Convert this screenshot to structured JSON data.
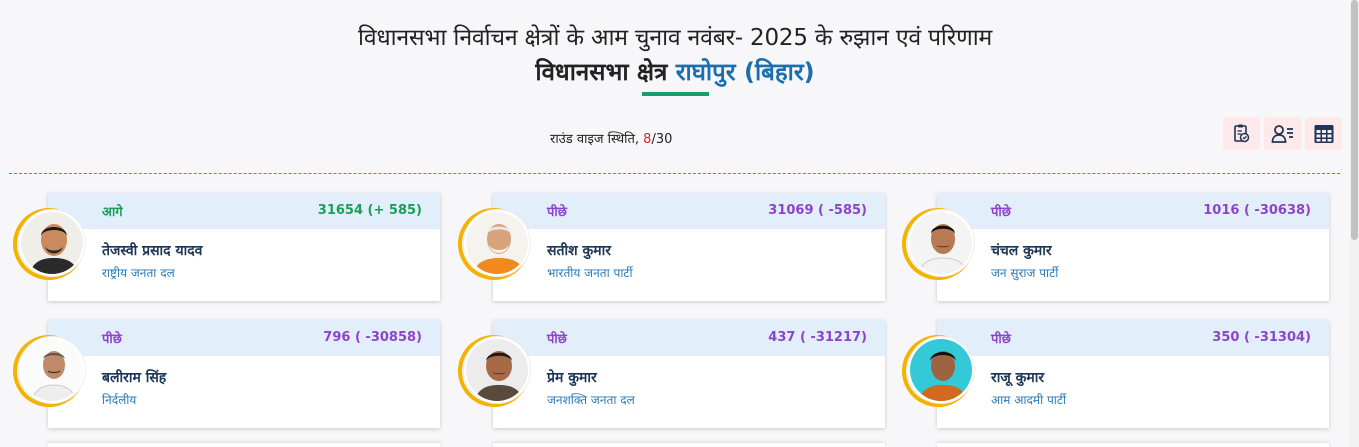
{
  "header": {
    "title_line1": "विधानसभा निर्वाचन क्षेत्रों के आम चुनाव नवंबर- 2025 के रुझान एवं परिणाम",
    "title_prefix": "विधानसभा क्षेत्र ",
    "constituency": "राघोपुर",
    "state": "(बिहार)"
  },
  "round": {
    "label": "राउंड वाइज स्थिति, ",
    "current": "8",
    "total": "/30"
  },
  "toolbar": {
    "icons": [
      "report-icon",
      "candidate-list-icon",
      "table-view-icon"
    ]
  },
  "colors": {
    "lead": "#1b9e5a",
    "trail": "#8e44c8",
    "accent_underline": "#15a06b",
    "ring": "#f5b301"
  },
  "candidates": [
    {
      "status": "आगे",
      "votes": "31654 (+ 585)",
      "name": "तेजस्वी प्रसाद यादव",
      "party": "राष्ट्रीय जनता दल",
      "leading": true
    },
    {
      "status": "पीछे",
      "votes": "31069 ( -585)",
      "name": "सतीश कुमार",
      "party": "भारतीय जनता पार्टी",
      "leading": false
    },
    {
      "status": "पीछे",
      "votes": "1016 ( -30638)",
      "name": "चंचल कुमार",
      "party": "जन सुराज पार्टी",
      "leading": false
    },
    {
      "status": "पीछे",
      "votes": "796 ( -30858)",
      "name": "बलीराम सिंह",
      "party": "निर्दलीय",
      "leading": false
    },
    {
      "status": "पीछे",
      "votes": "437 ( -31217)",
      "name": "प्रेम कुमार",
      "party": "जनशक्ति जनता दल",
      "leading": false
    },
    {
      "status": "पीछे",
      "votes": "350 ( -31304)",
      "name": "राजू कुमार",
      "party": "आम आदमी पार्टी",
      "leading": false
    }
  ]
}
